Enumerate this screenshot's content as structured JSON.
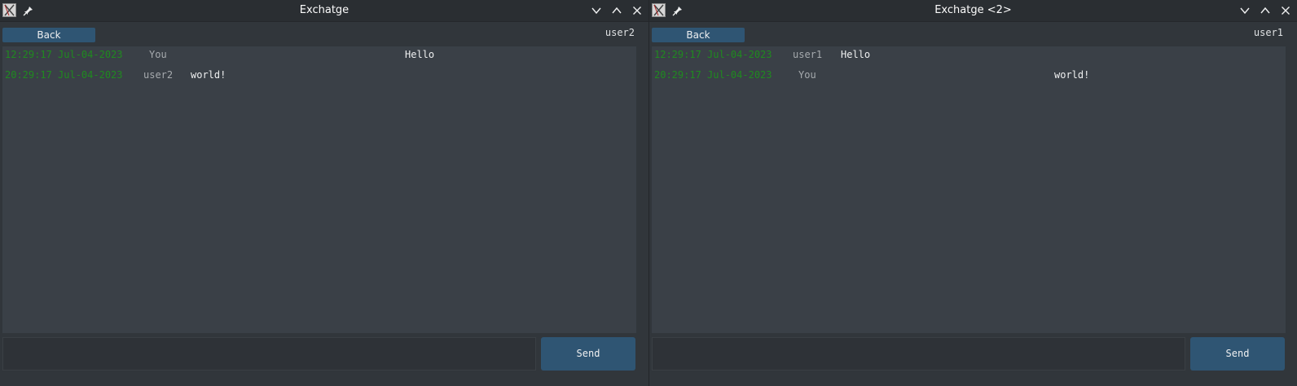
{
  "left": {
    "title": "Exchatge",
    "back_label": "Back",
    "peer": "user2",
    "messages": [
      {
        "time": "12:29:17 Jul-04-2023",
        "sender": "You",
        "text": "Hello"
      },
      {
        "time": "20:29:17 Jul-04-2023",
        "sender": "user2",
        "text": "world!"
      }
    ],
    "input_value": "",
    "send_label": "Send"
  },
  "right": {
    "title": "Exchatge <2>",
    "back_label": "Back",
    "peer": "user1",
    "messages": [
      {
        "time": "12:29:17 Jul-04-2023",
        "sender": "user1",
        "text": "Hello"
      },
      {
        "time": "20:29:17 Jul-04-2023",
        "sender": "You",
        "text": "world!"
      }
    ],
    "input_value": "",
    "send_label": "Send"
  },
  "icons": {
    "app": "app-icon",
    "pin": "pin-icon",
    "minimize": "chevron-down-icon",
    "maximize": "chevron-up-icon",
    "close": "close-icon"
  },
  "colors": {
    "window_bg": "#31363b",
    "chat_bg": "#3a4047",
    "accent": "#2f5573",
    "timestamp": "#1f8a1f",
    "sender": "#a6aaae",
    "text": "#eff0f1"
  }
}
